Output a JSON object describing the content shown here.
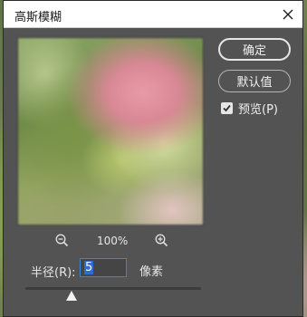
{
  "dialog": {
    "title": "高斯模糊",
    "close_icon": "close-icon"
  },
  "buttons": {
    "ok": "确定",
    "default": "默认值"
  },
  "preview": {
    "checkbox_label": "预览(P)",
    "checked": true,
    "zoom_out_icon": "zoom-out-icon",
    "zoom_in_icon": "zoom-in-icon",
    "zoom_level": "100%"
  },
  "radius": {
    "label": "半径(R):",
    "value": "5",
    "unit": "像素",
    "slider_value": 5
  },
  "colors": {
    "dialog_bg": "#535353",
    "accent": "#2f8bd8"
  }
}
